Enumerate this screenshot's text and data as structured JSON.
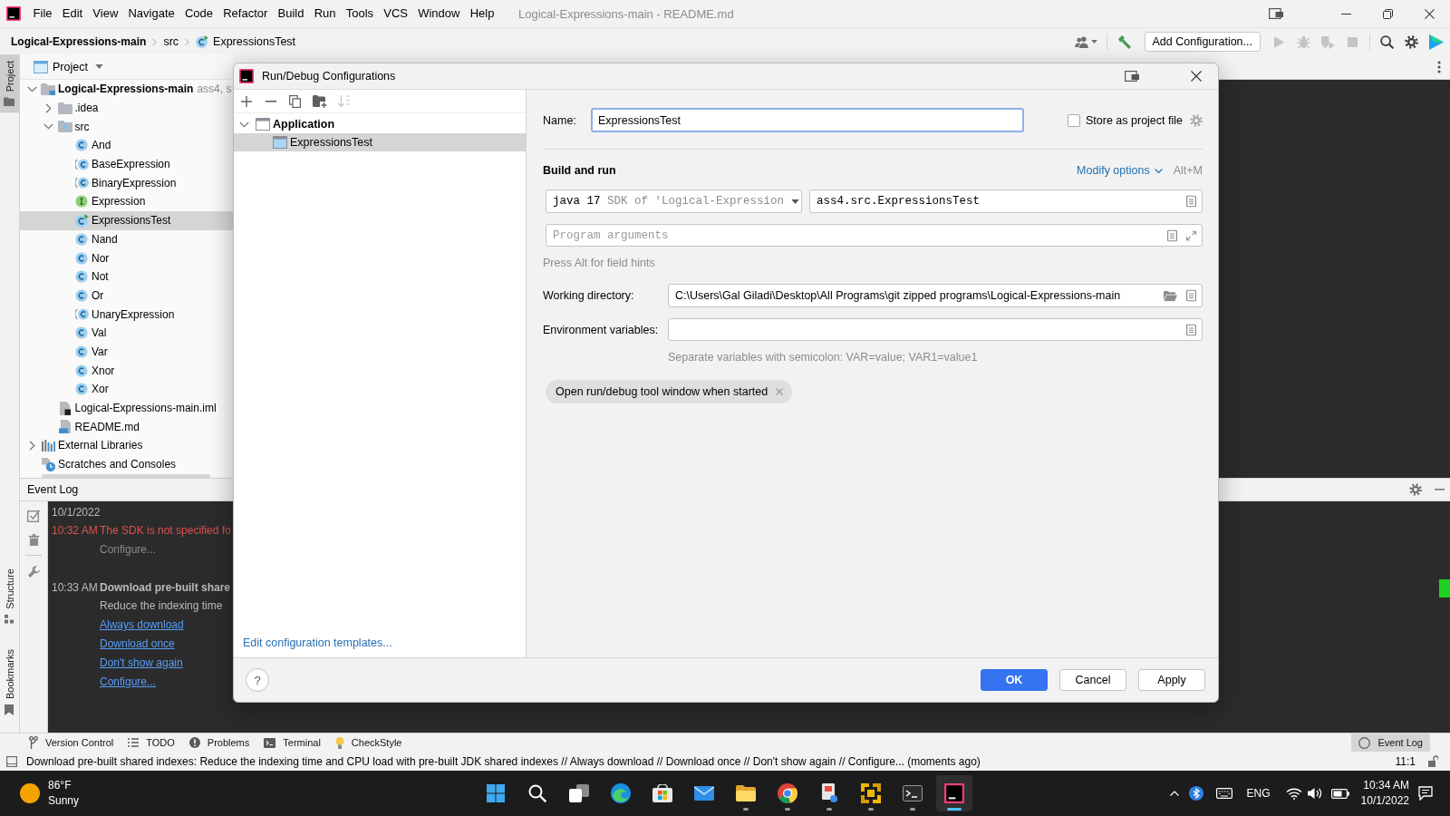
{
  "menubar": {
    "menus": [
      "File",
      "Edit",
      "View",
      "Navigate",
      "Code",
      "Refactor",
      "Build",
      "Run",
      "Tools",
      "VCS",
      "Window",
      "Help"
    ],
    "title": "Logical-Expressions-main - README.md"
  },
  "navbar": {
    "breadcrumbs": [
      {
        "label": "Logical-Expressions-main",
        "kind": "project"
      },
      {
        "label": "src",
        "kind": "folder"
      },
      {
        "label": "ExpressionsTest",
        "kind": "test_class"
      }
    ],
    "actions": [
      {
        "kind": "users",
        "disabled": false
      },
      {
        "kind": "build",
        "disabled": false
      },
      {
        "kind": "run_config",
        "label": "Add Configuration...",
        "disabled": false
      },
      {
        "kind": "run",
        "disabled": true
      },
      {
        "kind": "debug",
        "disabled": true
      },
      {
        "kind": "coverage",
        "disabled": true
      },
      {
        "kind": "stop",
        "disabled": true
      },
      {
        "kind": "search",
        "disabled": false
      },
      {
        "kind": "settings",
        "disabled": false
      },
      {
        "kind": "toolbox",
        "disabled": false
      }
    ]
  },
  "left_stripe": {
    "tabs": [
      {
        "label": "Project",
        "kind": "project",
        "selected": true
      },
      {
        "label": "Structure",
        "kind": "structure",
        "selected": false
      },
      {
        "label": "Bookmarks",
        "kind": "bookmarks",
        "selected": false
      }
    ]
  },
  "project_panel": {
    "title": "Project",
    "tree": [
      {
        "label": "Logical-Expressions-main",
        "note": "ass4, s",
        "kind": "module",
        "expanded": true,
        "selected": false,
        "children": [
          {
            "label": ".idea",
            "kind": "folder",
            "expanded": false,
            "selected": false
          },
          {
            "label": "src",
            "kind": "source_folder",
            "expanded": true,
            "selected": false,
            "children": [
              {
                "label": "And",
                "kind": "class",
                "selected": false
              },
              {
                "label": "BaseExpression",
                "kind": "abstract_class",
                "selected": false
              },
              {
                "label": "BinaryExpression",
                "kind": "abstract_class",
                "selected": false
              },
              {
                "label": "Expression",
                "kind": "interface",
                "selected": false
              },
              {
                "label": "ExpressionsTest",
                "kind": "test_class",
                "selected": true
              },
              {
                "label": "Nand",
                "kind": "class",
                "selected": false
              },
              {
                "label": "Nor",
                "kind": "class",
                "selected": false
              },
              {
                "label": "Not",
                "kind": "class",
                "selected": false
              },
              {
                "label": "Or",
                "kind": "class",
                "selected": false
              },
              {
                "label": "UnaryExpression",
                "kind": "abstract_class",
                "selected": false
              },
              {
                "label": "Val",
                "kind": "class",
                "selected": false
              },
              {
                "label": "Var",
                "kind": "class",
                "selected": false
              },
              {
                "label": "Xnor",
                "kind": "class",
                "selected": false
              },
              {
                "label": "Xor",
                "kind": "class",
                "selected": false
              }
            ]
          },
          {
            "label": "Logical-Expressions-main.iml",
            "kind": "iml_file",
            "selected": false
          },
          {
            "label": "README.md",
            "kind": "markdown_file",
            "selected": false
          }
        ]
      },
      {
        "label": "External Libraries",
        "kind": "libraries",
        "expanded": false,
        "selected": false
      },
      {
        "label": "Scratches and Consoles",
        "kind": "scratches",
        "selected": false
      }
    ]
  },
  "dialog": {
    "title": "Run/Debug Configurations",
    "toolbar": [
      {
        "kind": "add",
        "disabled": false
      },
      {
        "kind": "remove",
        "disabled": false
      },
      {
        "kind": "copy",
        "disabled": false
      },
      {
        "kind": "new_folder",
        "disabled": false
      },
      {
        "kind": "sort",
        "disabled": true
      }
    ],
    "tree": [
      {
        "label": "Application",
        "expanded": true,
        "selected": false,
        "children": [
          {
            "label": "ExpressionsTest",
            "selected": true
          }
        ]
      }
    ],
    "templates_link": "Edit configuration templates...",
    "form": {
      "name": {
        "label": "Name:",
        "value": "ExpressionsTest",
        "focused": true
      },
      "store_as_project_file": {
        "label": "Store as project file",
        "checked": false
      },
      "section_title": "Build and run",
      "modify_options": {
        "label": "Modify options",
        "shortcut": "Alt+M"
      },
      "sdk": {
        "value": "java 17",
        "detail": "SDK of 'Logical-Expression"
      },
      "main_class": {
        "value": "ass4.src.ExpressionsTest"
      },
      "program_arguments": {
        "placeholder": "Program arguments"
      },
      "field_hint": "Press Alt for field hints",
      "working_directory": {
        "label": "Working directory:",
        "value": "C:\\Users\\Gal Giladi\\Desktop\\All Programs\\git zipped programs\\Logical-Expressions-main"
      },
      "environment_variables": {
        "label": "Environment variables:",
        "hint": "Separate variables with semicolon: VAR=value; VAR1=value1"
      },
      "options": [
        {
          "label": "Open run/debug tool window when started"
        }
      ]
    },
    "help": "?",
    "buttons": [
      {
        "label": "OK",
        "kind": "primary"
      },
      {
        "label": "Cancel",
        "kind": "secondary"
      },
      {
        "label": "Apply",
        "kind": "secondary"
      }
    ]
  },
  "event_log": {
    "title": "Event Log",
    "date": "10/1/2022",
    "entries": [
      {
        "time": "10:32 AM",
        "kind": "error",
        "title": "The SDK is not specified fo",
        "lines": [
          "Configure..."
        ]
      },
      {
        "time": "10:33 AM",
        "kind": "notice",
        "title": "Download pre-built share",
        "lines": [
          "Reduce the indexing time"
        ],
        "links": [
          "Always download",
          "Download once",
          "Don't show again",
          "Configure..."
        ]
      }
    ]
  },
  "tool_windows": {
    "left": [
      {
        "label": "Version Control",
        "kind": "vcs",
        "selected": false
      },
      {
        "label": "TODO",
        "kind": "todo",
        "selected": false
      },
      {
        "label": "Problems",
        "kind": "problems",
        "selected": false
      },
      {
        "label": "Terminal",
        "kind": "terminal",
        "selected": false
      },
      {
        "label": "CheckStyle",
        "kind": "checkstyle",
        "selected": false
      }
    ],
    "right": [
      {
        "label": "Event Log",
        "kind": "event_log",
        "selected": true
      }
    ]
  },
  "status_bar": {
    "message": "Download pre-built shared indexes: Reduce the indexing time and CPU load with pre-built JDK shared indexes // Always download // Download once // Don't show again // Configure... (moments ago)",
    "position": "11:1"
  },
  "taskbar": {
    "weather": {
      "temperature": "86°F",
      "condition": "Sunny"
    },
    "apps": [
      {
        "kind": "start",
        "running": false,
        "active": false
      },
      {
        "kind": "search",
        "running": false,
        "active": false
      },
      {
        "kind": "task_view",
        "running": false,
        "active": false
      },
      {
        "kind": "browser_swirl",
        "running": false,
        "active": false
      },
      {
        "kind": "store",
        "running": false,
        "active": false
      },
      {
        "kind": "mail",
        "running": false,
        "active": false
      },
      {
        "kind": "files",
        "running": true,
        "active": false
      },
      {
        "kind": "browser_ring",
        "running": true,
        "active": false
      },
      {
        "kind": "snip",
        "running": true,
        "active": false
      },
      {
        "kind": "arrows",
        "running": true,
        "active": false
      },
      {
        "kind": "terminal",
        "running": true,
        "active": false
      },
      {
        "kind": "ide",
        "running": true,
        "active": true
      }
    ],
    "tray": {
      "language": "ENG",
      "time": "10:34 AM",
      "date": "10/1/2022"
    }
  }
}
